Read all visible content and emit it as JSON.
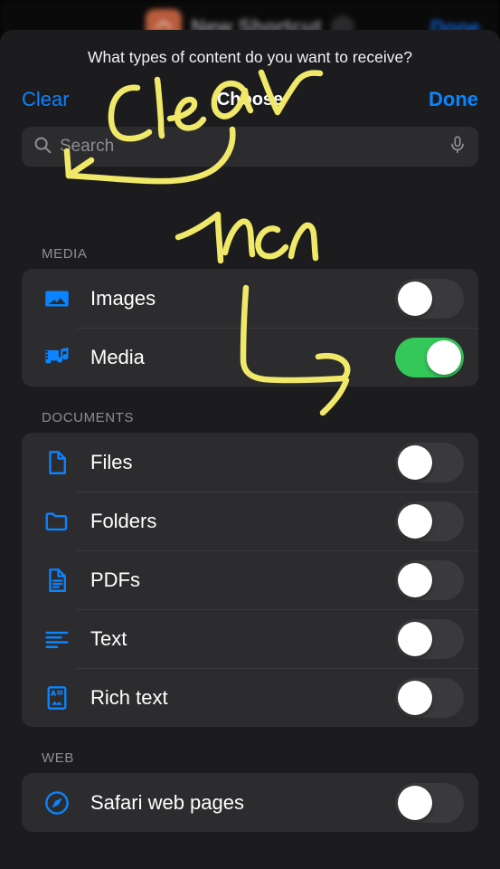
{
  "background_app": {
    "title": "New Shortcut",
    "done_label": "Done",
    "app_icon": "shortcuts-app-icon"
  },
  "sheet": {
    "prompt": "What types of content do you want to receive?",
    "clear_label": "Clear",
    "heading": "Choose",
    "done_label": "Done"
  },
  "search": {
    "placeholder": "Search",
    "value": "",
    "search_icon": "search-icon",
    "mic_icon": "microphone-icon"
  },
  "sections": [
    {
      "header": "MEDIA",
      "rows": [
        {
          "label": "Images",
          "icon": "photo-icon",
          "enabled": false
        },
        {
          "label": "Media",
          "icon": "film-music-icon",
          "enabled": true
        }
      ]
    },
    {
      "header": "DOCUMENTS",
      "rows": [
        {
          "label": "Files",
          "icon": "document-icon",
          "enabled": false
        },
        {
          "label": "Folders",
          "icon": "folder-icon",
          "enabled": false
        },
        {
          "label": "PDFs",
          "icon": "pdf-document-icon",
          "enabled": false
        },
        {
          "label": "Text",
          "icon": "text-lines-icon",
          "enabled": false
        },
        {
          "label": "Rich text",
          "icon": "rich-text-icon",
          "enabled": false
        }
      ]
    },
    {
      "header": "WEB",
      "rows": [
        {
          "label": "Safari web pages",
          "icon": "safari-compass-icon",
          "enabled": false
        }
      ]
    }
  ],
  "annotations": {
    "ink_color": "#f0e868",
    "notes": [
      {
        "text": "clear",
        "points_to": "clear-button"
      },
      {
        "text": "then",
        "points_to": "media-toggle"
      }
    ]
  },
  "colors": {
    "accent_blue": "#0a84ff",
    "toggle_on_green": "#34c759",
    "toggle_off_gray": "#3a3a3c",
    "sheet_bg": "#1c1c1e",
    "card_bg": "#2c2c2e",
    "icon_blue": "#0a84ff",
    "section_header_gray": "#8e8e93"
  }
}
